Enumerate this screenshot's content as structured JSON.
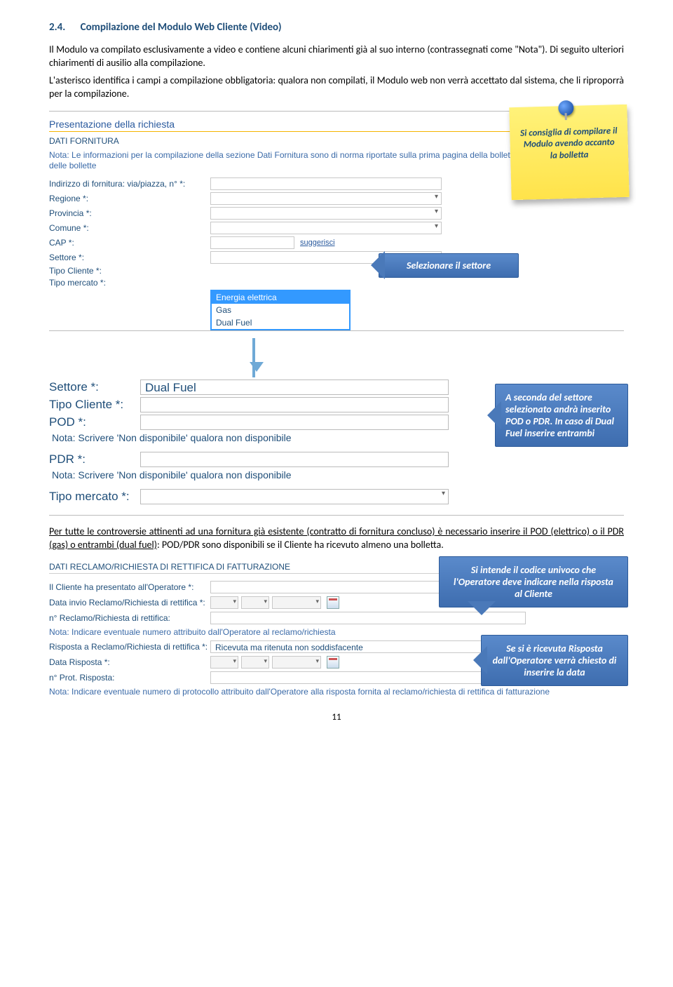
{
  "heading": {
    "num": "2.4.",
    "title": "Compilazione del Modulo Web Cliente (Video)"
  },
  "para1": "Il Modulo va compilato esclusivamente a video e contiene alcuni chiarimenti già al suo interno (contrassegnati come \"Nota\"). Di seguito ulteriori chiarimenti di ausilio alla compilazione.",
  "para2": "L'asterisco identifica i campi a compilazione obbligatoria: qualora non compilati, il Modulo web non verrà accettato dal sistema, che li riproporrà per la compilazione.",
  "sticky": "Si consiglia di compilare il Modulo avendo accanto la bolletta",
  "form1": {
    "section_title": "Presentazione della richiesta",
    "caps": "DATI FORNITURA",
    "note": "Nota: Le informazioni per la compilazione della sezione Dati Fornitura sono di norma riportate sulla prima pagina della bolletta. Se diverso, in recapito delle bollette",
    "labels": {
      "indirizzo": "Indirizzo di fornitura: via/piazza, n° *:",
      "regione": "Regione *:",
      "provincia": "Provincia *:",
      "comune": "Comune *:",
      "cap": "CAP *:",
      "settore": "Settore *:",
      "tipo_cliente": "Tipo Cliente *:",
      "tipo_mercato": "Tipo mercato *:",
      "suggerisci": "suggerisci"
    },
    "dropdown": {
      "sel": "Energia elettrica",
      "opts": [
        "Energia elettrica",
        "Gas",
        "Dual Fuel"
      ]
    }
  },
  "callout1": "Selezionare il settore",
  "form2": {
    "labels": {
      "settore": "Settore *:",
      "tipo_cliente": "Tipo Cliente *:",
      "pod": "POD *:",
      "pdr": "PDR *:",
      "tipo_mercato": "Tipo mercato *:"
    },
    "settore_value": "Dual Fuel",
    "note_pod": "Nota: Scrivere 'Non disponibile' qualora non disponibile",
    "note_pdr": "Nota: Scrivere 'Non disponibile' qualora non disponibile"
  },
  "callout2": "A seconda del settore selezionato andrà inserito POD o PDR. In caso di Dual Fuel inserire entrambi",
  "para3a": "Per tutte le controversie attinenti ad una fornitura già esistente (contratto di fornitura concluso) è necessario inserire il POD (elettrico) o il PDR (gas) o entrambi (dual fuel)",
  "para3b": ": POD/PDR sono disponibili se il Cliente ha ricevuto almeno una bolletta.",
  "form3": {
    "section_title": "DATI RECLAMO/RICHIESTA DI RETTIFICA DI FATTURAZIONE",
    "labels": {
      "presentato": "Il Cliente ha presentato all'Operatore *:",
      "data_invio": "Data invio Reclamo/Richiesta di rettifica *:",
      "num_reclamo": "n° Reclamo/Richiesta di rettifica:",
      "nota1": "Nota: Indicare eventuale numero attribuito dall'Operatore al reclamo/richiesta",
      "risposta": "Risposta a Reclamo/Richiesta di rettifica *:",
      "data_risposta": "Data Risposta *:",
      "num_prot": "n° Prot. Risposta:",
      "nota2": "Nota: Indicare eventuale numero di protocollo attribuito dall'Operatore alla risposta fornita al reclamo/richiesta di rettifica di fatturazione"
    },
    "risposta_value": "Ricevuta ma ritenuta non soddisfacente"
  },
  "callout3": "Si intende il codice univoco che l'Operatore deve indicare nella risposta al Cliente",
  "callout4": "Se si è ricevuta Risposta dall'Operatore verrà chiesto di inserire la data",
  "page": "11"
}
